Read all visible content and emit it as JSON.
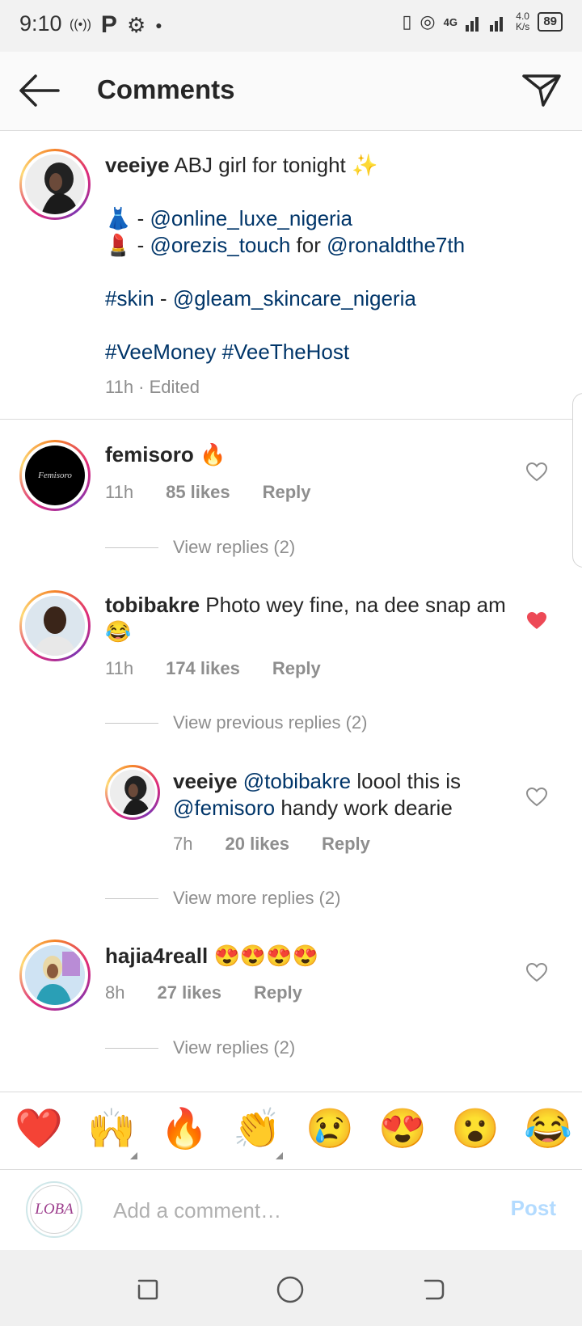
{
  "status_bar": {
    "time": "9:10",
    "speed": "4.0",
    "speed_unit": "K/s",
    "battery": "89",
    "network": "4G"
  },
  "header": {
    "title": "Comments",
    "back_icon": "arrow-left-icon",
    "send_icon": "paper-plane-icon"
  },
  "caption": {
    "username": "veeiye",
    "line1_text": "ABJ girl for tonight",
    "line1_emoji": "✨",
    "dress_emoji": "👗",
    "dress_sep": " - ",
    "dress_mention": "@online_luxe_nigeria",
    "lipstick_emoji": "💄",
    "lipstick_sep": " - ",
    "lipstick_mention": "@orezis_touch",
    "lipstick_for": " for ",
    "lipstick_mention2": "@ronaldthe7th",
    "skin_tag": "#skin",
    "skin_sep": " - ",
    "skin_mention": "@gleam_skincare_nigeria",
    "tag1": "#VeeMoney",
    "tag2": "#VeeTheHost",
    "meta": "11h · Edited"
  },
  "comments": [
    {
      "username": "femisoro",
      "text": "🔥",
      "time": "11h",
      "likes": "85 likes",
      "reply": "Reply",
      "view_replies": "View replies (2)",
      "avatar_label": "Femisoro"
    },
    {
      "username": "tobibakre",
      "text": "Photo wey fine, na dee snap am 😂",
      "time": "11h",
      "likes": "174 likes",
      "reply": "Reply",
      "view_replies": "View previous replies (2)",
      "liked": true
    },
    {
      "username": "veeiye",
      "mention1": "@tobibakre",
      "text1": " loool this is",
      "mention2": "@femisoro",
      "text2": " handy work dearie",
      "time": "7h",
      "likes": "20 likes",
      "reply": "Reply",
      "view_replies": "View more replies (2)"
    },
    {
      "username": "hajia4reall",
      "text": "😍😍😍😍",
      "time": "8h",
      "likes": "27 likes",
      "reply": "Reply",
      "view_replies": "View replies (2)"
    }
  ],
  "quick_reactions": [
    "❤️",
    "🙌",
    "🔥",
    "👏",
    "😢",
    "😍",
    "😮",
    "😂"
  ],
  "comment_box": {
    "avatar_label": "LOBA",
    "placeholder": "Add a comment…",
    "post_label": "Post"
  },
  "colors": {
    "link": "#003569",
    "muted": "#8e8e8e",
    "liked_heart": "#ed4956",
    "post_disabled": "#b3dbff"
  }
}
